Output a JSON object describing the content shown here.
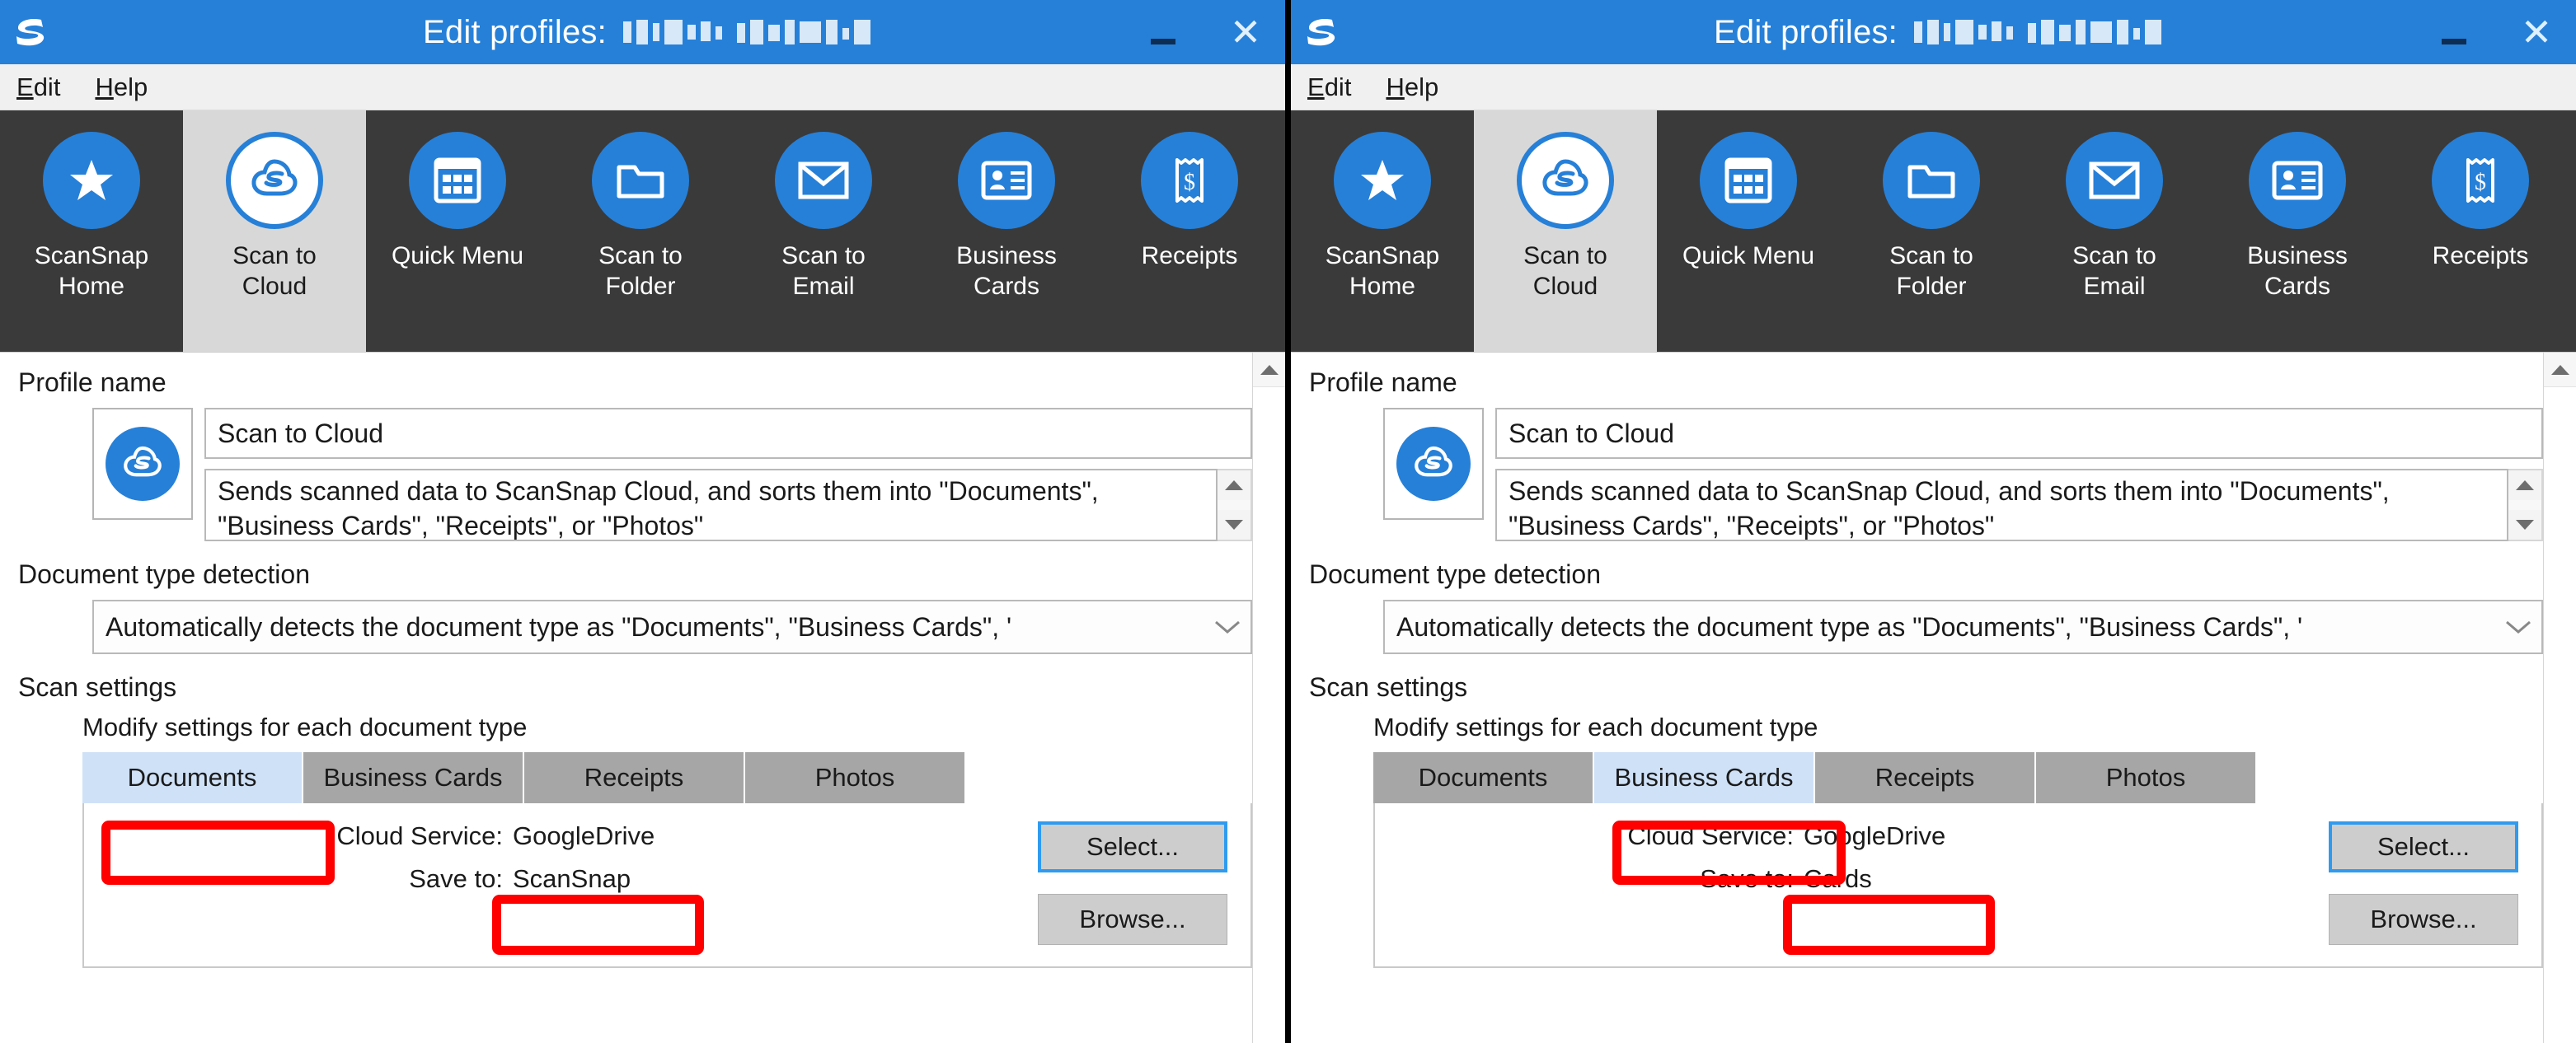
{
  "window": {
    "title_prefix": "Edit profiles:",
    "title_redacted": true,
    "minimize_label": "Minimize",
    "close_label": "Close"
  },
  "menu": {
    "items": [
      {
        "label": "Edit",
        "mnemonic": "E"
      },
      {
        "label": "Help",
        "mnemonic": "H"
      }
    ]
  },
  "toolbar": {
    "items": [
      {
        "label": "ScanSnap\nHome",
        "icon": "star-icon",
        "selected": false
      },
      {
        "label": "Scan to\nCloud",
        "icon": "cloud-s-icon",
        "selected": true
      },
      {
        "label": "Quick Menu",
        "icon": "grid-icon",
        "selected": false
      },
      {
        "label": "Scan to\nFolder",
        "icon": "folder-icon",
        "selected": false
      },
      {
        "label": "Scan to\nEmail",
        "icon": "envelope-icon",
        "selected": false
      },
      {
        "label": "Business\nCards",
        "icon": "id-card-icon",
        "selected": false
      },
      {
        "label": "Receipts",
        "icon": "receipt-icon",
        "selected": false
      }
    ]
  },
  "profile": {
    "section_label": "Profile name",
    "name_value": "Scan to Cloud",
    "description_value": "Sends scanned data to ScanSnap Cloud, and sorts them into \"Documents\", \"Business Cards\", \"Receipts\", or \"Photos\""
  },
  "document_type_detection": {
    "section_label": "Document type detection",
    "value": "Automatically detects the document type as \"Documents\", \"Business Cards\", '"
  },
  "scan_settings": {
    "section_label": "Scan settings",
    "modify_label": "Modify settings for each document type",
    "tabs": [
      "Documents",
      "Business Cards",
      "Receipts",
      "Photos"
    ],
    "cloud_service_label": "Cloud Service:",
    "save_to_label": "Save to:",
    "select_button": "Select...",
    "browse_button": "Browse..."
  },
  "panels": {
    "left": {
      "active_tab_index": 0,
      "cloud_service_value": "GoogleDrive",
      "save_to_value": "ScanSnap"
    },
    "right": {
      "active_tab_index": 1,
      "cloud_service_value": "GoogleDrive",
      "save_to_value": "Cards"
    }
  },
  "colors": {
    "titlebar": "#2680d8",
    "toolbar": "#3a3a3a",
    "accent": "#2680d8",
    "tab_active": "#cfe1f7",
    "tab_inactive": "#a6a6a6",
    "annotation": "#ff0000"
  }
}
